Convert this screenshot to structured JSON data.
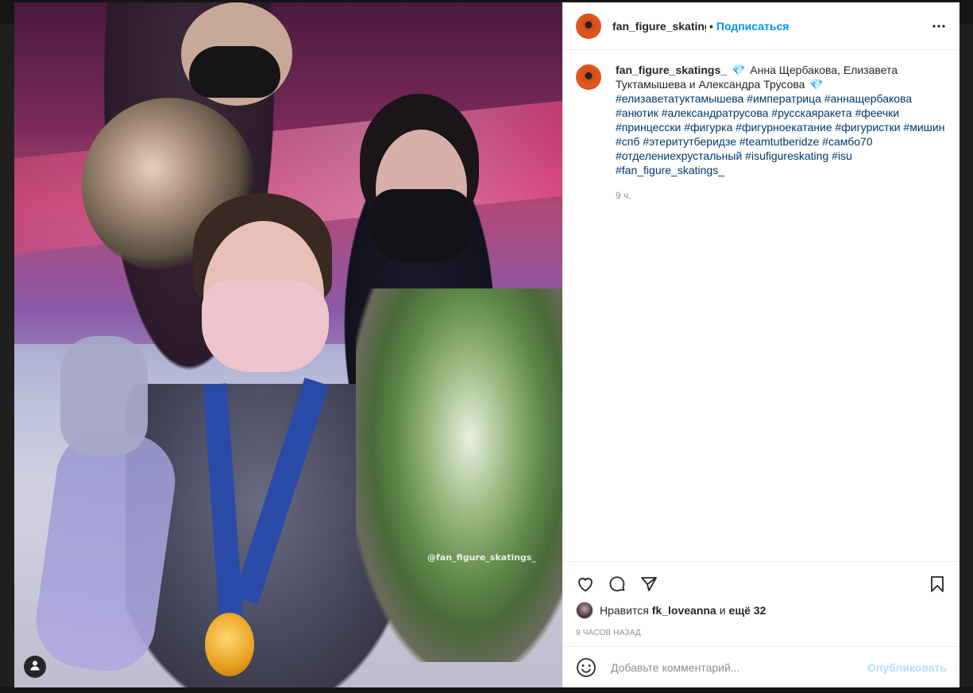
{
  "post": {
    "username": "fan_figure_skatings_",
    "header_username": "fan_figure_skatings",
    "dot": "•",
    "follow_label": "Подписаться",
    "caption_username": "fan_figure_skatings_",
    "caption_diamond": "💎",
    "caption_text": "Анна Щербакова, Елизавета Туктамышева и Александра Трусова",
    "hashtags": "#елизаветатуктамышева #императрица #аннащербакова #анютик #александратрусова #русскаяракета #феечки #принцесски #фигурка #фигурноекатание #фигуристки #мишин #спб #этеритутберидзе #teamtutberidze #самбо70 #отделениехрустальный #isufigureskating #isu #fan_figure_skatings_",
    "caption_time": "9 ч.",
    "watermark": "@fan_figure_skatings_",
    "likes_prefix": "Нравится",
    "likes_user": "fk_loveanna",
    "likes_and": "и",
    "likes_more": "ещё 32",
    "post_time": "9 ЧАСОВ НАЗАД",
    "comment_placeholder": "Добавьте комментарий...",
    "publish_label": "Опубликовать"
  },
  "icons": {
    "more": "more-options-icon",
    "like": "heart-icon",
    "comment": "comment-icon",
    "share": "paper-plane-icon",
    "save": "bookmark-icon",
    "emoji": "emoji-icon",
    "user_tag": "user-icon"
  },
  "colors": {
    "accent": "#0095f6",
    "hashtag": "#00376b",
    "publish_disabled": "#b2dffc",
    "muted": "#8e8e8e"
  }
}
